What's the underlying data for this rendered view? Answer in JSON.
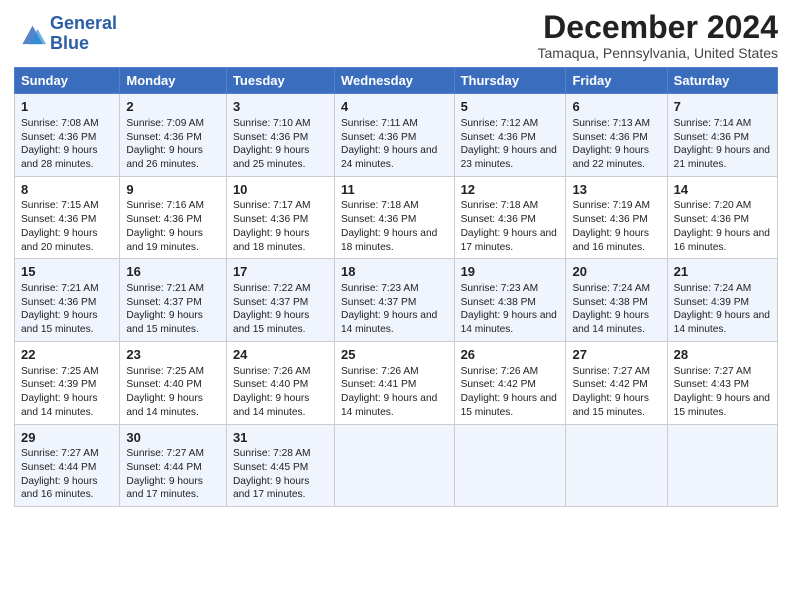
{
  "logo": {
    "line1": "General",
    "line2": "Blue"
  },
  "title": "December 2024",
  "subtitle": "Tamaqua, Pennsylvania, United States",
  "headers": [
    "Sunday",
    "Monday",
    "Tuesday",
    "Wednesday",
    "Thursday",
    "Friday",
    "Saturday"
  ],
  "weeks": [
    [
      {
        "day": "1",
        "sunrise": "7:08 AM",
        "sunset": "4:36 PM",
        "daylight": "9 hours and 28 minutes."
      },
      {
        "day": "2",
        "sunrise": "7:09 AM",
        "sunset": "4:36 PM",
        "daylight": "9 hours and 26 minutes."
      },
      {
        "day": "3",
        "sunrise": "7:10 AM",
        "sunset": "4:36 PM",
        "daylight": "9 hours and 25 minutes."
      },
      {
        "day": "4",
        "sunrise": "7:11 AM",
        "sunset": "4:36 PM",
        "daylight": "9 hours and 24 minutes."
      },
      {
        "day": "5",
        "sunrise": "7:12 AM",
        "sunset": "4:36 PM",
        "daylight": "9 hours and 23 minutes."
      },
      {
        "day": "6",
        "sunrise": "7:13 AM",
        "sunset": "4:36 PM",
        "daylight": "9 hours and 22 minutes."
      },
      {
        "day": "7",
        "sunrise": "7:14 AM",
        "sunset": "4:36 PM",
        "daylight": "9 hours and 21 minutes."
      }
    ],
    [
      {
        "day": "8",
        "sunrise": "7:15 AM",
        "sunset": "4:36 PM",
        "daylight": "9 hours and 20 minutes."
      },
      {
        "day": "9",
        "sunrise": "7:16 AM",
        "sunset": "4:36 PM",
        "daylight": "9 hours and 19 minutes."
      },
      {
        "day": "10",
        "sunrise": "7:17 AM",
        "sunset": "4:36 PM",
        "daylight": "9 hours and 18 minutes."
      },
      {
        "day": "11",
        "sunrise": "7:18 AM",
        "sunset": "4:36 PM",
        "daylight": "9 hours and 18 minutes."
      },
      {
        "day": "12",
        "sunrise": "7:18 AM",
        "sunset": "4:36 PM",
        "daylight": "9 hours and 17 minutes."
      },
      {
        "day": "13",
        "sunrise": "7:19 AM",
        "sunset": "4:36 PM",
        "daylight": "9 hours and 16 minutes."
      },
      {
        "day": "14",
        "sunrise": "7:20 AM",
        "sunset": "4:36 PM",
        "daylight": "9 hours and 16 minutes."
      }
    ],
    [
      {
        "day": "15",
        "sunrise": "7:21 AM",
        "sunset": "4:36 PM",
        "daylight": "9 hours and 15 minutes."
      },
      {
        "day": "16",
        "sunrise": "7:21 AM",
        "sunset": "4:37 PM",
        "daylight": "9 hours and 15 minutes."
      },
      {
        "day": "17",
        "sunrise": "7:22 AM",
        "sunset": "4:37 PM",
        "daylight": "9 hours and 15 minutes."
      },
      {
        "day": "18",
        "sunrise": "7:23 AM",
        "sunset": "4:37 PM",
        "daylight": "9 hours and 14 minutes."
      },
      {
        "day": "19",
        "sunrise": "7:23 AM",
        "sunset": "4:38 PM",
        "daylight": "9 hours and 14 minutes."
      },
      {
        "day": "20",
        "sunrise": "7:24 AM",
        "sunset": "4:38 PM",
        "daylight": "9 hours and 14 minutes."
      },
      {
        "day": "21",
        "sunrise": "7:24 AM",
        "sunset": "4:39 PM",
        "daylight": "9 hours and 14 minutes."
      }
    ],
    [
      {
        "day": "22",
        "sunrise": "7:25 AM",
        "sunset": "4:39 PM",
        "daylight": "9 hours and 14 minutes."
      },
      {
        "day": "23",
        "sunrise": "7:25 AM",
        "sunset": "4:40 PM",
        "daylight": "9 hours and 14 minutes."
      },
      {
        "day": "24",
        "sunrise": "7:26 AM",
        "sunset": "4:40 PM",
        "daylight": "9 hours and 14 minutes."
      },
      {
        "day": "25",
        "sunrise": "7:26 AM",
        "sunset": "4:41 PM",
        "daylight": "9 hours and 14 minutes."
      },
      {
        "day": "26",
        "sunrise": "7:26 AM",
        "sunset": "4:42 PM",
        "daylight": "9 hours and 15 minutes."
      },
      {
        "day": "27",
        "sunrise": "7:27 AM",
        "sunset": "4:42 PM",
        "daylight": "9 hours and 15 minutes."
      },
      {
        "day": "28",
        "sunrise": "7:27 AM",
        "sunset": "4:43 PM",
        "daylight": "9 hours and 15 minutes."
      }
    ],
    [
      {
        "day": "29",
        "sunrise": "7:27 AM",
        "sunset": "4:44 PM",
        "daylight": "9 hours and 16 minutes."
      },
      {
        "day": "30",
        "sunrise": "7:27 AM",
        "sunset": "4:44 PM",
        "daylight": "9 hours and 17 minutes."
      },
      {
        "day": "31",
        "sunrise": "7:28 AM",
        "sunset": "4:45 PM",
        "daylight": "9 hours and 17 minutes."
      },
      null,
      null,
      null,
      null
    ]
  ],
  "labels": {
    "sunrise": "Sunrise: ",
    "sunset": "Sunset: ",
    "daylight": "Daylight: "
  }
}
